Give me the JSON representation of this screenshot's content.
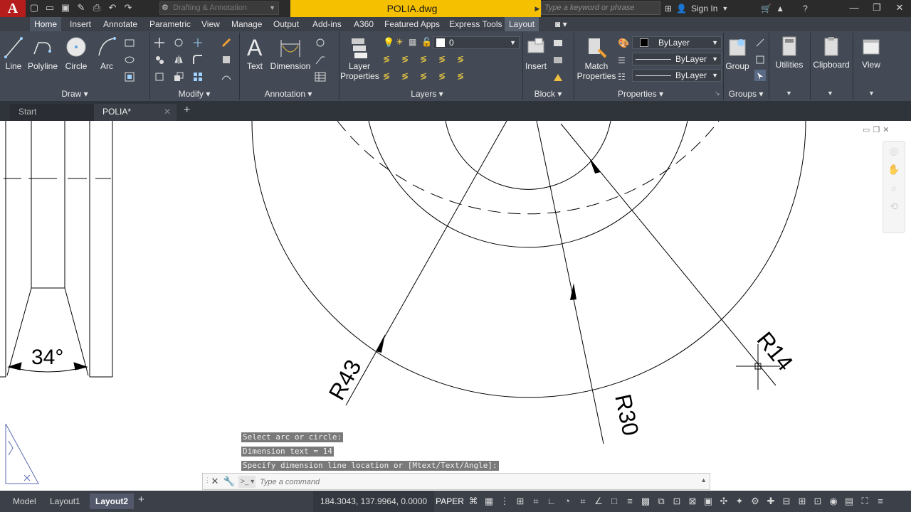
{
  "app": {
    "logo": "A",
    "document_title": "POLIA.dwg",
    "workspace": "Drafting & Annotation"
  },
  "search": {
    "placeholder": "Type a keyword or phrase"
  },
  "account": {
    "sign_in": "Sign In"
  },
  "ribbon_tabs": [
    "Home",
    "Insert",
    "Annotate",
    "Parametric",
    "View",
    "Manage",
    "Output",
    "Add-ins",
    "A360",
    "Featured Apps",
    "Express Tools",
    "Layout"
  ],
  "draw": {
    "line": "Line",
    "polyline": "Polyline",
    "circle": "Circle",
    "arc": "Arc",
    "panel": "Draw"
  },
  "modify": {
    "panel": "Modify"
  },
  "annotation": {
    "text": "Text",
    "dimension": "Dimension",
    "panel": "Annotation"
  },
  "layers": {
    "layer_properties_1": "Layer",
    "layer_properties_2": "Properties",
    "current_layer": "0",
    "panel": "Layers"
  },
  "block": {
    "insert": "Insert",
    "panel": "Block"
  },
  "properties": {
    "match_1": "Match",
    "match_2": "Properties",
    "color": "ByLayer",
    "linetype": "ByLayer",
    "lineweight": "ByLayer",
    "panel": "Properties"
  },
  "groups": {
    "group": "Group",
    "panel": "Groups"
  },
  "misc": {
    "utilities": "Utilities",
    "clipboard": "Clipboard",
    "view": "View"
  },
  "file_tabs": {
    "start": "Start",
    "current": "POLIA*"
  },
  "drawing": {
    "angle_label": "34°",
    "dim_r43": "R43",
    "dim_r30": "R30",
    "dim_r14": "R14"
  },
  "command": {
    "history": [
      "Select arc or circle:",
      "Dimension text = 14",
      "Specify dimension line location or [Mtext/Text/Angle]:"
    ],
    "placeholder": "Type a command"
  },
  "status": {
    "tabs": [
      "Model",
      "Layout1",
      "Layout2"
    ],
    "active_tab": "Layout2",
    "coordinates": "184.3043, 137.9964, 0.0000",
    "space": "PAPER"
  },
  "colors": {
    "accent_title": "#f5c000",
    "ribbon": "#434a55",
    "app_button": "#b51d1d"
  }
}
